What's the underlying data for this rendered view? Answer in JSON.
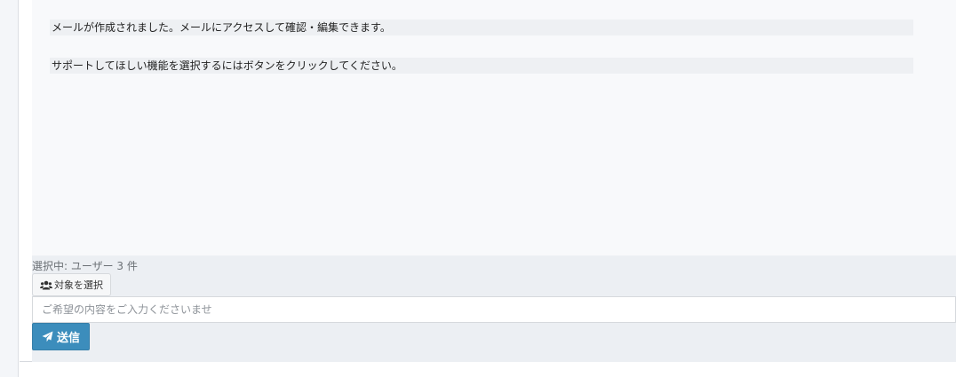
{
  "messages": [
    {
      "text": "メールが作成されました。メールにアクセスして確認・編集できます。"
    },
    {
      "text": "サポートしてほしい機能を選択するにはボタンをクリックしてください。"
    }
  ],
  "composer": {
    "selected_info": "選択中: ユーザー 3 件",
    "target_button_label": "対象を選択",
    "target_button_icon": "users-icon",
    "input_placeholder": "ご希望の内容をご入力くださいませ",
    "input_value": "",
    "send_button_label": "送信",
    "send_button_icon": "paper-plane-icon"
  },
  "colors": {
    "primary": "#3c8dbc",
    "message_bg": "#eef0f3",
    "composer_bg": "#eceff3"
  }
}
